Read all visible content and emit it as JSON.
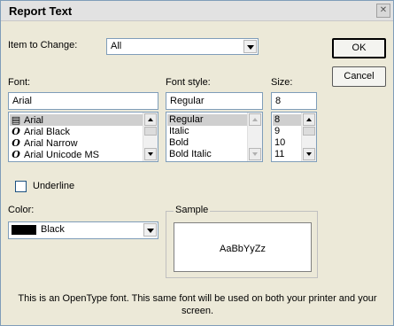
{
  "dialog": {
    "title": "Report Text",
    "close_glyph": "✕",
    "item_to_change_label": "Item to Change:",
    "item_to_change_value": "All",
    "ok_label": "OK",
    "cancel_label": "Cancel",
    "font_label": "Font:",
    "font_value": "Arial",
    "font_list": [
      {
        "icon": "truetype-printer-icon",
        "glyph": "▤",
        "label": "Arial",
        "selected": true
      },
      {
        "icon": "opentype-icon",
        "glyph": "O",
        "label": "Arial Black",
        "selected": false
      },
      {
        "icon": "opentype-icon",
        "glyph": "O",
        "label": "Arial Narrow",
        "selected": false
      },
      {
        "icon": "opentype-icon",
        "glyph": "O",
        "label": "Arial Unicode MS",
        "selected": false
      }
    ],
    "style_label": "Font style:",
    "style_value": "Regular",
    "style_list": [
      "Regular",
      "Italic",
      "Bold",
      "Bold Italic"
    ],
    "size_label": "Size:",
    "size_value": "8",
    "size_list": [
      "8",
      "9",
      "10",
      "11"
    ],
    "underline_label": "Underline",
    "underline_checked": false,
    "color_label": "Color:",
    "color_value": "Black",
    "color_swatch": "#000000",
    "sample_label": "Sample",
    "sample_text": "AaBbYyZz",
    "description": "This is an OpenType font. This same font will be used on both your printer and your screen."
  }
}
